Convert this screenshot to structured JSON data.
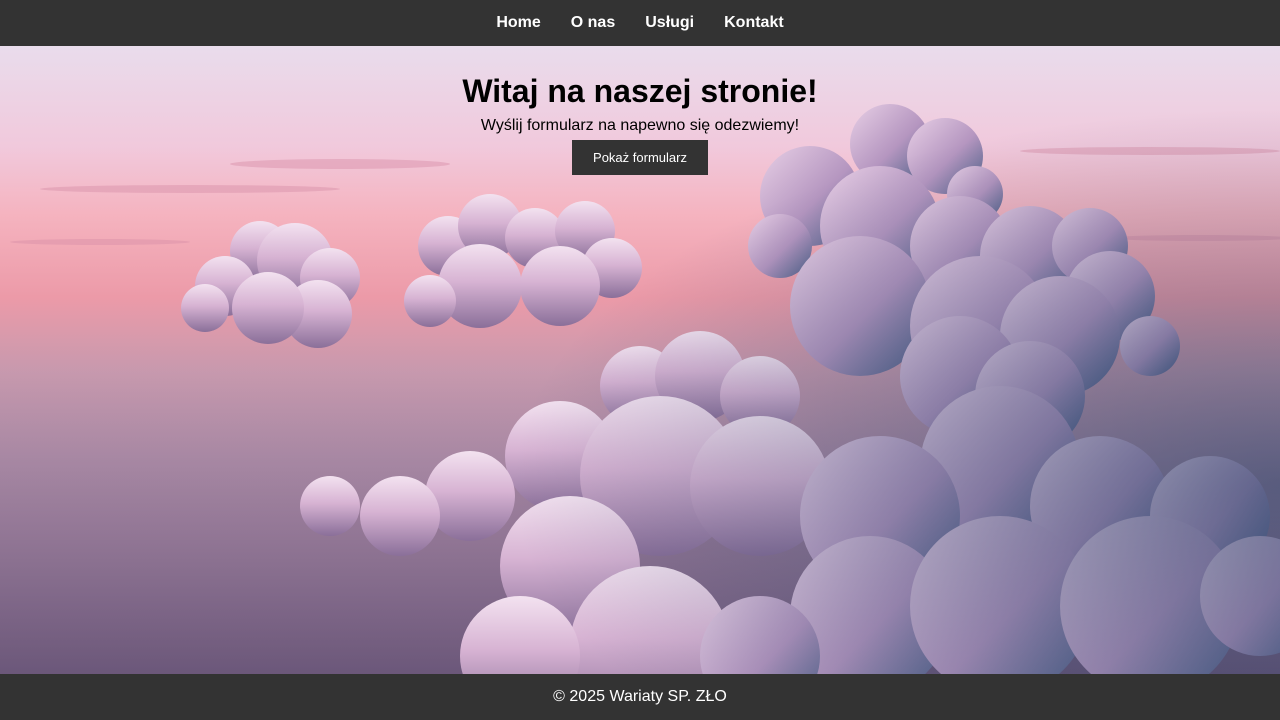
{
  "nav": {
    "items": [
      {
        "label": "Home"
      },
      {
        "label": "O nas"
      },
      {
        "label": "Usługi"
      },
      {
        "label": "Kontakt"
      }
    ]
  },
  "hero": {
    "title": "Witaj na naszej stronie!",
    "subtitle": "Wyślij formularz na napewno się odezwiemy!",
    "button_label": "Pokaż formularz",
    "background_image": "clouds-at-sunset"
  },
  "footer": {
    "text": "© 2025 Wariaty SP. ZŁO"
  },
  "colors": {
    "nav_background": "#333333",
    "footer_background": "#333333",
    "button_background": "#333333",
    "nav_text": "#ffffff",
    "hero_text": "#000000"
  }
}
